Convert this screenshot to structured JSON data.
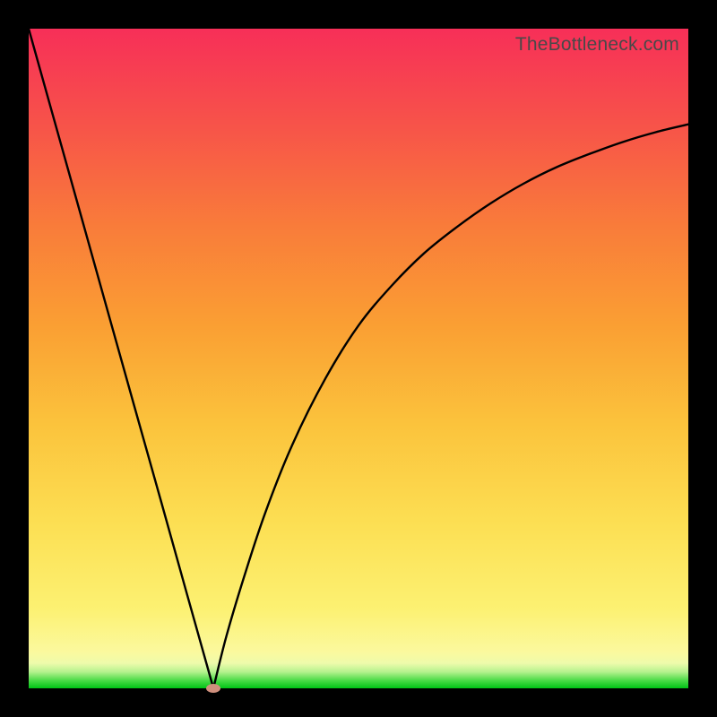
{
  "watermark": "TheBottleneck.com",
  "colors": {
    "frame": "#000000",
    "curve": "#000000",
    "dot": "#cf8f7d"
  },
  "chart_data": {
    "type": "line",
    "title": "",
    "xlabel": "",
    "ylabel": "",
    "xlim": [
      0,
      100
    ],
    "ylim": [
      0,
      100
    ],
    "x_min_point": 28,
    "series": [
      {
        "name": "left-branch",
        "x": [
          0,
          4,
          8,
          12,
          16,
          20,
          24,
          27,
          28
        ],
        "values": [
          100,
          85.7,
          71.4,
          57.1,
          42.8,
          28.6,
          14.3,
          3.6,
          0
        ]
      },
      {
        "name": "right-branch",
        "x": [
          28,
          30,
          33,
          36,
          40,
          45,
          50,
          55,
          60,
          65,
          70,
          75,
          80,
          85,
          90,
          95,
          100
        ],
        "values": [
          0,
          8,
          18,
          27,
          37,
          47,
          55,
          61,
          66,
          70,
          73.5,
          76.5,
          79,
          81,
          82.8,
          84.3,
          85.5
        ]
      }
    ],
    "marker": {
      "x": 28,
      "y": 0
    }
  }
}
